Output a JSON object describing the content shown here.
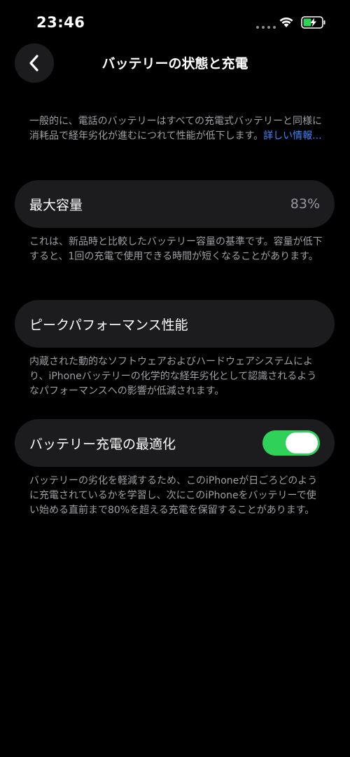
{
  "status_bar": {
    "time": "23:46"
  },
  "nav": {
    "title": "バッテリーの状態と充電"
  },
  "intro": {
    "text": "一般的に、電話のバッテリーはすべての充電式バッテリーと同様に消耗品で経年劣化が進むにつれて性能が低下します。",
    "link_label": "詳しい情報..."
  },
  "max_capacity": {
    "label": "最大容量",
    "value": "83%",
    "footer": "これは、新品時と比較したバッテリー容量の基準です。容量が低下すると、1回の充電で使用できる時間が短くなることがあります。"
  },
  "peak_performance": {
    "label": "ピークパフォーマンス性能",
    "footer": "内蔵された動的なソフトウェアおよびハードウェアシステムにより、iPhoneバッテリーの化学的な経年劣化として認識されるようなパフォーマンスへの影響が低減されます。"
  },
  "optimized_charging": {
    "label": "バッテリー充電の最適化",
    "enabled": true,
    "footer": "バッテリーの劣化を軽減するため、このiPhoneが日ごろどのように充電されているかを学習し、次にこのiPhoneをバッテリーで使い始める直前まで80%を超える充電を保留することがあります。"
  },
  "colors": {
    "toggle_on": "#30d158",
    "link": "#3a8bff",
    "card_bg": "#1c1c1e"
  },
  "icons": {
    "back": "chevron-left-icon",
    "wifi": "wifi-icon",
    "battery": "battery-charging-icon"
  }
}
